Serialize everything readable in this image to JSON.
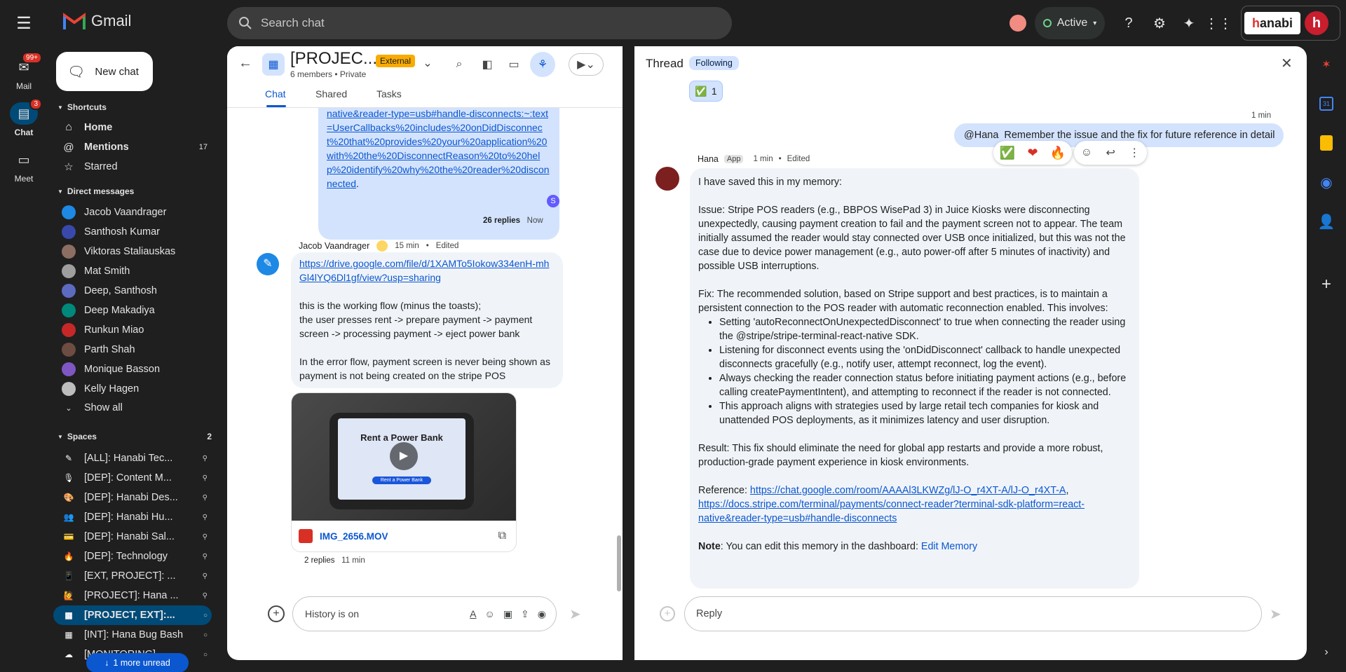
{
  "header": {
    "app_name": "Gmail",
    "search_placeholder": "Search chat",
    "status": "Active",
    "brand": "anabi",
    "brand_initial": "h"
  },
  "rail": {
    "mail": {
      "label": "Mail",
      "badge": "99+"
    },
    "chat": {
      "label": "Chat",
      "badge": "3"
    },
    "meet": {
      "label": "Meet"
    }
  },
  "sidebar": {
    "new_chat": "New chat",
    "shortcuts_label": "Shortcuts",
    "shortcuts": [
      {
        "label": "Home",
        "count": ""
      },
      {
        "label": "Mentions",
        "count": "17"
      },
      {
        "label": "Starred",
        "count": ""
      }
    ],
    "dm_label": "Direct messages",
    "dms": [
      {
        "label": "Jacob Vaandrager",
        "color": "#1e88e5"
      },
      {
        "label": "Santhosh Kumar",
        "color": "#3949ab"
      },
      {
        "label": "Viktoras Staliauskas",
        "color": "#8d6e63"
      },
      {
        "label": "Mat Smith",
        "color": "#9e9e9e"
      },
      {
        "label": "Deep, Santhosh",
        "color": "#5c6bc0"
      },
      {
        "label": "Deep Makadiya",
        "color": "#00897b"
      },
      {
        "label": "Runkun Miao",
        "color": "#c62828"
      },
      {
        "label": "Parth Shah",
        "color": "#6d4c41"
      },
      {
        "label": "Monique Basson",
        "color": "#7e57c2"
      },
      {
        "label": "Kelly Hagen",
        "color": "#bdbdbd"
      }
    ],
    "show_all": "Show all",
    "spaces_label": "Spaces",
    "spaces_count": "2",
    "spaces": [
      {
        "label": "[ALL]: Hanabi Tec...",
        "icon": "✎",
        "selected": false
      },
      {
        "label": "[DEP]: Content M...",
        "icon": "🎙",
        "selected": false
      },
      {
        "label": "[DEP]: Hanabi Des...",
        "icon": "🎨",
        "selected": false
      },
      {
        "label": "[DEP]: Hanabi Hu...",
        "icon": "👥",
        "selected": false
      },
      {
        "label": "[DEP]: Hanabi Sal...",
        "icon": "💳",
        "selected": false
      },
      {
        "label": "[DEP]: Technology",
        "icon": "🔥",
        "selected": false
      },
      {
        "label": "[EXT, PROJECT]: ...",
        "icon": "📱",
        "selected": false
      },
      {
        "label": "[PROJECT]: Hana ...",
        "icon": "🙋",
        "selected": false
      },
      {
        "label": "[PROJECT, EXT]:...",
        "icon": "▦",
        "selected": true
      },
      {
        "label": "[INT]: Hana Bug Bash",
        "icon": "▦",
        "selected": false
      },
      {
        "label": "[MONITORING]...",
        "icon": "☁",
        "selected": false
      }
    ],
    "more_unread": "1 more unread"
  },
  "chat": {
    "title": "[PROJEC...",
    "external_badge": "External",
    "members": "6 members",
    "privacy": "Private",
    "tabs": [
      "Chat",
      "Shared",
      "Tasks"
    ],
    "top_link": "native&reader-type=usb#handle-disconnects:~:text=UserCallbacks%20includes%20onDidDisconnect%20that%20provides%20your%20application%20with%20the%20DisconnectReason%20to%20help%20identify%20why%20the%20reader%20disconnected",
    "top_link_end": ".",
    "top_replies": "26 replies",
    "top_replies_time": "Now",
    "msg_author": "Jacob Vaandrager",
    "msg_time": "15 min",
    "msg_edited": "Edited",
    "msg_link": "https://drive.google.com/file/d/1XAMTo5Iokow334enH-mhGl4lYQ6Dl1gf/view?usp=sharing",
    "msg_text_1": "this is the working flow (minus the toasts);",
    "msg_text_2": "the user presses rent -> prepare payment -> payment screen -> processing payment -> eject power bank",
    "msg_text_3": "In the error flow, payment screen is never being shown as payment is not being created on the stripe POS",
    "video_title": "Rent a Power Bank",
    "video_button": "Rent a Power Bank",
    "video_file": "IMG_2656.MOV",
    "bottom_replies": "2 replies",
    "bottom_replies_time": "11 min",
    "composer_placeholder": "History is on"
  },
  "thread": {
    "title": "Thread",
    "following": "Following",
    "reaction_count": "1",
    "user_time": "1 min",
    "user_mention": "@Hana",
    "user_message": "Remember the issue and the fix for future reference in detail",
    "reply_author": "Hana",
    "reply_tag": "App",
    "reply_time": "1 min",
    "reply_edited": "Edited",
    "intro": "I have saved this in my memory:",
    "issue": "Issue: Stripe POS readers (e.g., BBPOS WisePad 3) in Juice Kiosks were disconnecting unexpectedly, causing payment creation to fail and the payment screen not to appear. The team initially assumed the reader would stay connected over USB once initialized, but this was not the case due to device power management (e.g., auto power-off after 5 minutes of inactivity) and possible USB interruptions.",
    "fix": "Fix: The recommended solution, based on Stripe support and best practices, is to maintain a persistent connection to the POS reader with automatic reconnection enabled. This involves:",
    "fix_items": [
      "Setting 'autoReconnectOnUnexpectedDisconnect' to true when connecting the reader using the @stripe/stripe-terminal-react-native SDK.",
      "Listening for disconnect events using the 'onDidDisconnect' callback to handle unexpected disconnects gracefully (e.g., notify user, attempt reconnect, log the event).",
      "Always checking the reader connection status before initiating payment actions (e.g., before calling createPaymentIntent), and attempting to reconnect if the reader is not connected.",
      "This approach aligns with strategies used by large retail tech companies for kiosk and unattended POS deployments, as it minimizes latency and user disruption."
    ],
    "result": "Result: This fix should eliminate the need for global app restarts and provide a more robust, production-grade payment experience in kiosk environments.",
    "reference_label": "Reference: ",
    "reference_link_1": "https://chat.google.com/room/AAAAl3LKWZg/lJ-O_r4XT-A/lJ-O_r4XT-A",
    "reference_sep": ",",
    "reference_link_2": "https://docs.stripe.com/terminal/payments/connect-reader?terminal-sdk-platform=react-native&reader-type=usb#handle-disconnects",
    "note_label": "Note",
    "note_text": ": You can edit this memory in the dashboard: ",
    "note_link": "Edit Memory",
    "reply_placeholder": "Reply"
  },
  "colors": {
    "accent": "#0b57d0",
    "bubble_blue": "#d3e3fd",
    "bubble_gray": "#f0f4f9",
    "external": "#f9ab00"
  }
}
